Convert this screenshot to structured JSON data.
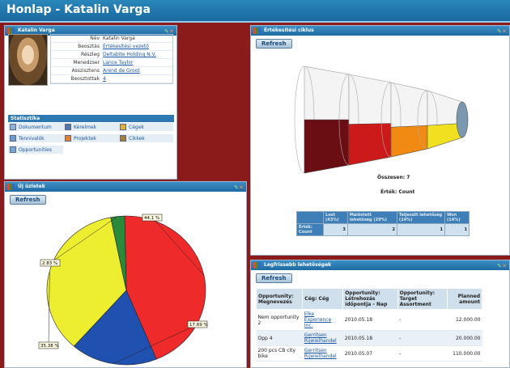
{
  "page": {
    "title": "Honlap - Katalin Varga"
  },
  "profile": {
    "panel_title": "Katalin Varga",
    "fields": [
      {
        "label": "Név",
        "value": "Katalin Varga"
      },
      {
        "label": "Beosztás",
        "value": "Értékesítési vezető"
      },
      {
        "label": "Részleg",
        "value": "Deltabite Holding N.V."
      },
      {
        "label": "Menedzser",
        "value": "Lance Taylor"
      },
      {
        "label": "Asszisztens",
        "value": "Arend de Groot"
      },
      {
        "label": "Beosztottak",
        "value": "4"
      }
    ],
    "stats_title": "Statisztika",
    "stats": [
      {
        "label": "Dokumentum",
        "icon": "document-icon",
        "color": "#8ab4e0"
      },
      {
        "label": "Kérelmek",
        "icon": "requests-icon",
        "color": "#5078b0"
      },
      {
        "label": "Cégek",
        "icon": "companies-icon",
        "color": "#e0b030"
      },
      {
        "label": "Tennivalók",
        "icon": "tasks-icon",
        "color": "#6a9cd0"
      },
      {
        "label": "Projektek",
        "icon": "projects-icon",
        "color": "#e08030"
      },
      {
        "label": "Cikkek",
        "icon": "articles-icon",
        "color": "#a08040"
      },
      {
        "label": "Opportunities",
        "icon": "opportunities-icon",
        "color": "#70a8d8"
      }
    ]
  },
  "deals": {
    "panel_title": "Új üzletek",
    "refresh_label": "Refresh",
    "chart_data": {
      "type": "pie",
      "values": [
        44.1,
        17.69,
        35.38,
        2.83
      ],
      "labels": [
        "44.1 %",
        "17.69 %",
        "35.38 %",
        "2.83 %"
      ],
      "colors": [
        "#ee2a2a",
        "#2050b0",
        "#eeee30",
        "#2a8a3a"
      ]
    }
  },
  "cycle": {
    "panel_title": "Értékesítési ciklus",
    "refresh_label": "Refresh",
    "total_label": "Összesen: 7",
    "value_label": "Érték: Count",
    "chart_data": {
      "type": "funnel",
      "categories": [
        "Lost (43%)",
        "Maiöstett lehetőség (29%)",
        "Teljesült lehetőség (14%)",
        "Won (14%)"
      ],
      "values": [
        3,
        2,
        1,
        1
      ],
      "colors": [
        "#6a0e14",
        "#cc1a1a",
        "#f08a12",
        "#f0e020"
      ]
    },
    "table": {
      "headers": [
        "Lost (43%)",
        "Maiöstett lehetőség (29%)",
        "Teljesült lehetőség (14%)",
        "Won (14%)"
      ],
      "row_label": "Érték: Count",
      "values": [
        "3",
        "2",
        "1",
        "1"
      ]
    }
  },
  "best": {
    "panel_title": "Legfrissebb lehetőségek",
    "refresh_label": "Refresh",
    "headers": [
      "Opportunity: Megnevezés",
      "Cég: Cég",
      "Opportunity: Létrehozás időpontja - Nap",
      "Opportunity: Target Assortment",
      "Planned amount"
    ],
    "rows": [
      {
        "name": "Nem opportunity 2",
        "company": "Elke Experience Inc.",
        "date": "2010.05.18",
        "target": "-",
        "amount": "12.000.00"
      },
      {
        "name": "Opp 4",
        "company": "Gerritsen Rijwielhandel",
        "date": "2010.05.18",
        "target": "-",
        "amount": "20.000.00"
      },
      {
        "name": "200 pcs CB city bike",
        "company": "Gerritsen Rijwielhandel",
        "date": "2010.05.07",
        "target": "-",
        "amount": "110.000.00"
      }
    ]
  }
}
